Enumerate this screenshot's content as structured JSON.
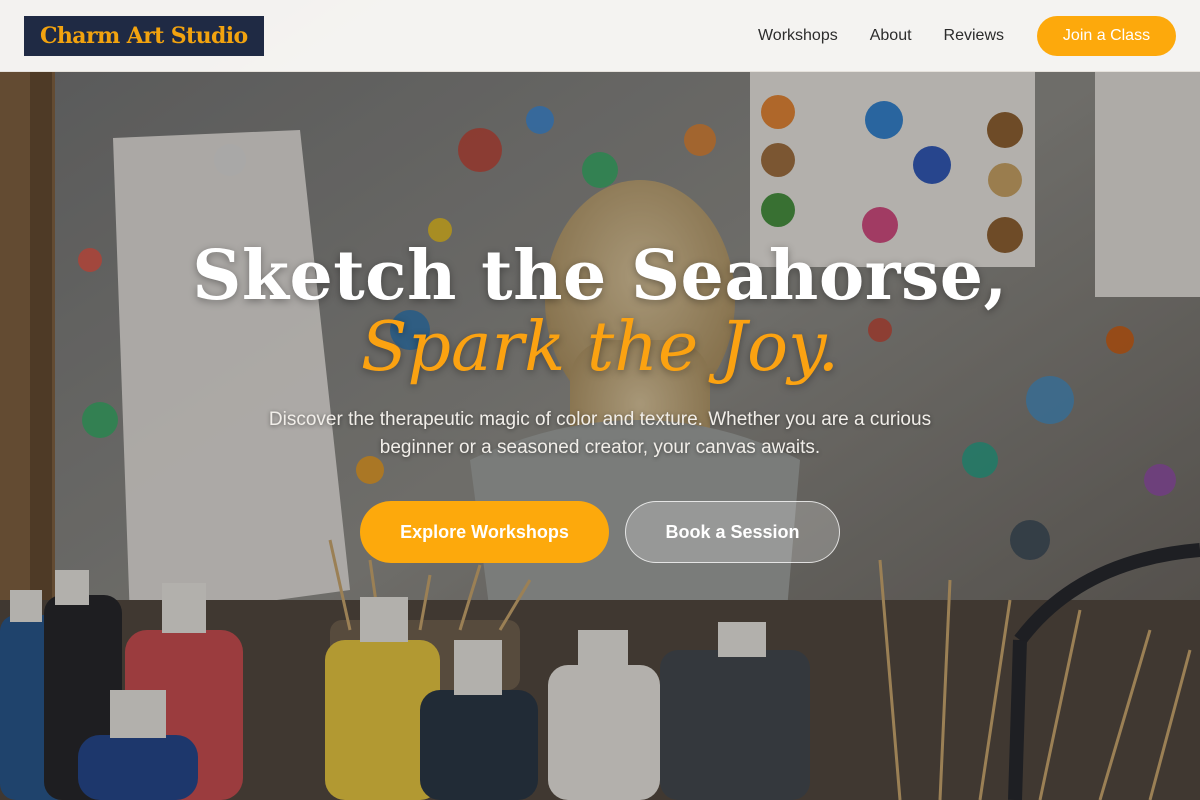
{
  "header": {
    "logo_text": "Charm Art Studio",
    "nav": [
      "Workshops",
      "About",
      "Reviews"
    ],
    "cta_label": "Join a Class"
  },
  "hero": {
    "headline": "Sketch the Seahorse,",
    "headline_accent": "Spark the Joy.",
    "subtitle": "Discover the therapeutic magic of color and texture. Whether you are a curious beginner or a seasoned creator, your canvas awaits.",
    "primary_cta": "Explore Workshops",
    "secondary_cta": "Book a Session"
  },
  "colors": {
    "accent": "#fda90c",
    "logo_bg": "#1f2a44",
    "header_bg": "#faf9f7",
    "nav_text": "#2c2c2c"
  },
  "background": {
    "description_icon": "painted-studio-photo"
  }
}
